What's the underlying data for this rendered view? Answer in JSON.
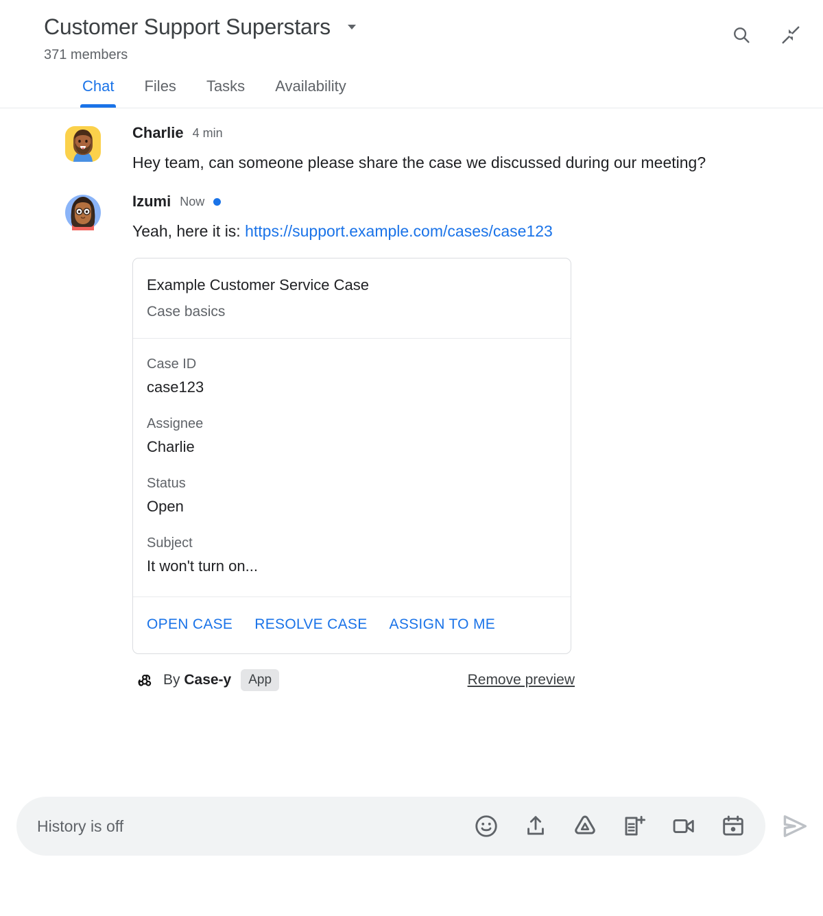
{
  "header": {
    "room_title": "Customer Support Superstars",
    "member_count": "371 members",
    "dropdown_icon": "chevron-down-icon",
    "search_icon": "search-icon",
    "collapse_icon": "collapse-icon"
  },
  "tabs": [
    {
      "label": "Chat",
      "active": true
    },
    {
      "label": "Files",
      "active": false
    },
    {
      "label": "Tasks",
      "active": false
    },
    {
      "label": "Availability",
      "active": false
    }
  ],
  "messages": [
    {
      "author": "Charlie",
      "time": "4 min",
      "unread": false,
      "text": "Hey team, can someone please share the case we discussed during our meeting?"
    },
    {
      "author": "Izumi",
      "time": "Now",
      "unread": true,
      "text_before_link": "Yeah, here it is: ",
      "link_text": "https://support.example.com/cases/case123"
    }
  ],
  "card": {
    "title": "Example Customer Service Case",
    "subtitle": "Case basics",
    "fields": [
      {
        "label": "Case ID",
        "value": "case123"
      },
      {
        "label": "Assignee",
        "value": "Charlie"
      },
      {
        "label": "Status",
        "value": "Open"
      },
      {
        "label": "Subject",
        "value": "It won't turn on..."
      }
    ],
    "actions": [
      {
        "label": "OPEN CASE"
      },
      {
        "label": "RESOLVE CASE"
      },
      {
        "label": "ASSIGN TO ME"
      }
    ],
    "footer": {
      "bot_icon": "webhook-icon",
      "by_prefix": "By ",
      "bot_name": "Case-y",
      "badge": "App",
      "remove_preview": "Remove preview"
    }
  },
  "composer": {
    "placeholder": "History is off",
    "tools": [
      {
        "name": "emoji-icon"
      },
      {
        "name": "upload-icon"
      },
      {
        "name": "drive-icon"
      },
      {
        "name": "add-doc-icon"
      },
      {
        "name": "video-icon"
      },
      {
        "name": "calendar-icon"
      }
    ],
    "send_icon": "send-icon"
  },
  "colors": {
    "accent": "#1a73e8",
    "text_primary": "#202124",
    "text_secondary": "#5f6368",
    "border": "#dadce0",
    "composer_bg": "#f1f3f4",
    "badge_bg": "#e4e5e7",
    "send_disabled": "#bdc1c6"
  }
}
